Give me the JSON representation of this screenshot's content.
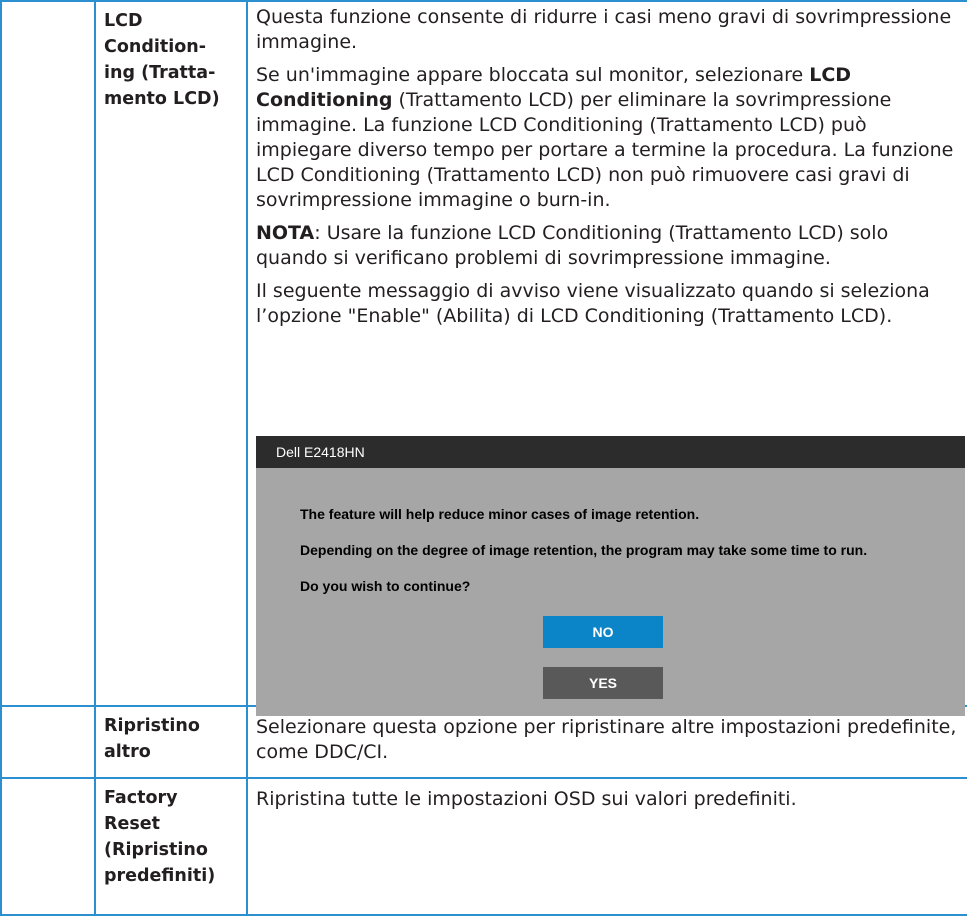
{
  "colors": {
    "border": "#2b8fd0",
    "osd_titlebar": "#2c2c2c",
    "osd_body": "#a6a6a6",
    "no_button": "#0c84c8",
    "yes_button": "#595959"
  },
  "rows": [
    {
      "label_lines": [
        "LCD",
        "Condition-",
        "ing (Tratta-",
        "mento LCD)"
      ],
      "paragraphs": {
        "p1": "Questa funzione consente di ridurre i casi meno gravi di sovrimpressione immagine.",
        "p2_before": "Se un'immagine appare bloccata sul monitor, selezionare ",
        "p2_bold": "LCD Conditioning",
        "p2_after": " (Trattamento LCD) per eliminare la sovrimpressione immagine. La funzione LCD Conditioning (Trattamento LCD) può impiegare diverso tempo per portare a termine la procedura. La funzione LCD Conditioning (Trattamento LCD) non può rimuovere casi gravi di sovrimpressione immagine o burn-in.",
        "p3_bold": "NOTA",
        "p3_after": ": Usare la funzione LCD Conditioning (Trattamento LCD) solo quando si verificano problemi di sovrimpressione immagine.",
        "p4": "Il seguente messaggio di avviso viene visualizzato quando si seleziona l’opzione \"Enable\" (Abilita) di LCD Conditioning (Trattamento LCD)."
      }
    },
    {
      "label_lines": [
        "Ripristino",
        "altro"
      ],
      "description": "Selezionare questa opzione per ripristinare altre impostazioni predefinite, come DDC/CI."
    },
    {
      "label_lines": [
        "Factory",
        "Reset",
        "(Ripristino",
        "predefiniti)"
      ],
      "description": "Ripristina tutte le impostazioni OSD sui valori predefiniti."
    }
  ],
  "osd": {
    "title": "Dell E2418HN",
    "line1": "The feature will help reduce minor cases of image retention.",
    "line2": "Depending on the degree of image retention, the program may take some time to run.",
    "line3": "Do you wish to continue?",
    "no_label": "NO",
    "yes_label": "YES"
  }
}
